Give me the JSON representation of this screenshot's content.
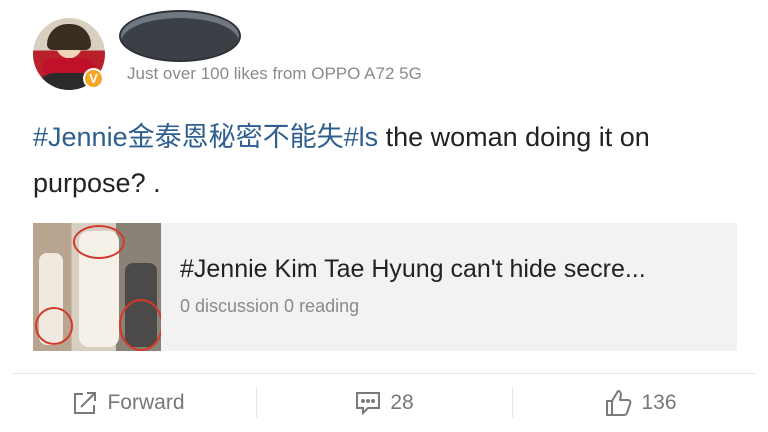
{
  "post": {
    "meta": "Just over 100 likes from OPPO A72 5G",
    "badge": "V",
    "text_tag": "#Jennie金泰恩秘密不能失#ls",
    "text_body": " the woman doing it on purpose? ."
  },
  "card": {
    "title": "#Jennie Kim Tae Hyung can't hide secre...",
    "subtitle": "0 discussion 0 reading"
  },
  "actions": {
    "forward_label": "Forward",
    "comments_count": "28",
    "likes_count": "136"
  },
  "icons": {
    "forward": "share-icon",
    "comment": "comment-icon",
    "like": "thumbs-up-icon"
  },
  "colors": {
    "hashtag": "#2f5f8f",
    "muted": "#8a8a8a",
    "badge": "#f5a623"
  }
}
